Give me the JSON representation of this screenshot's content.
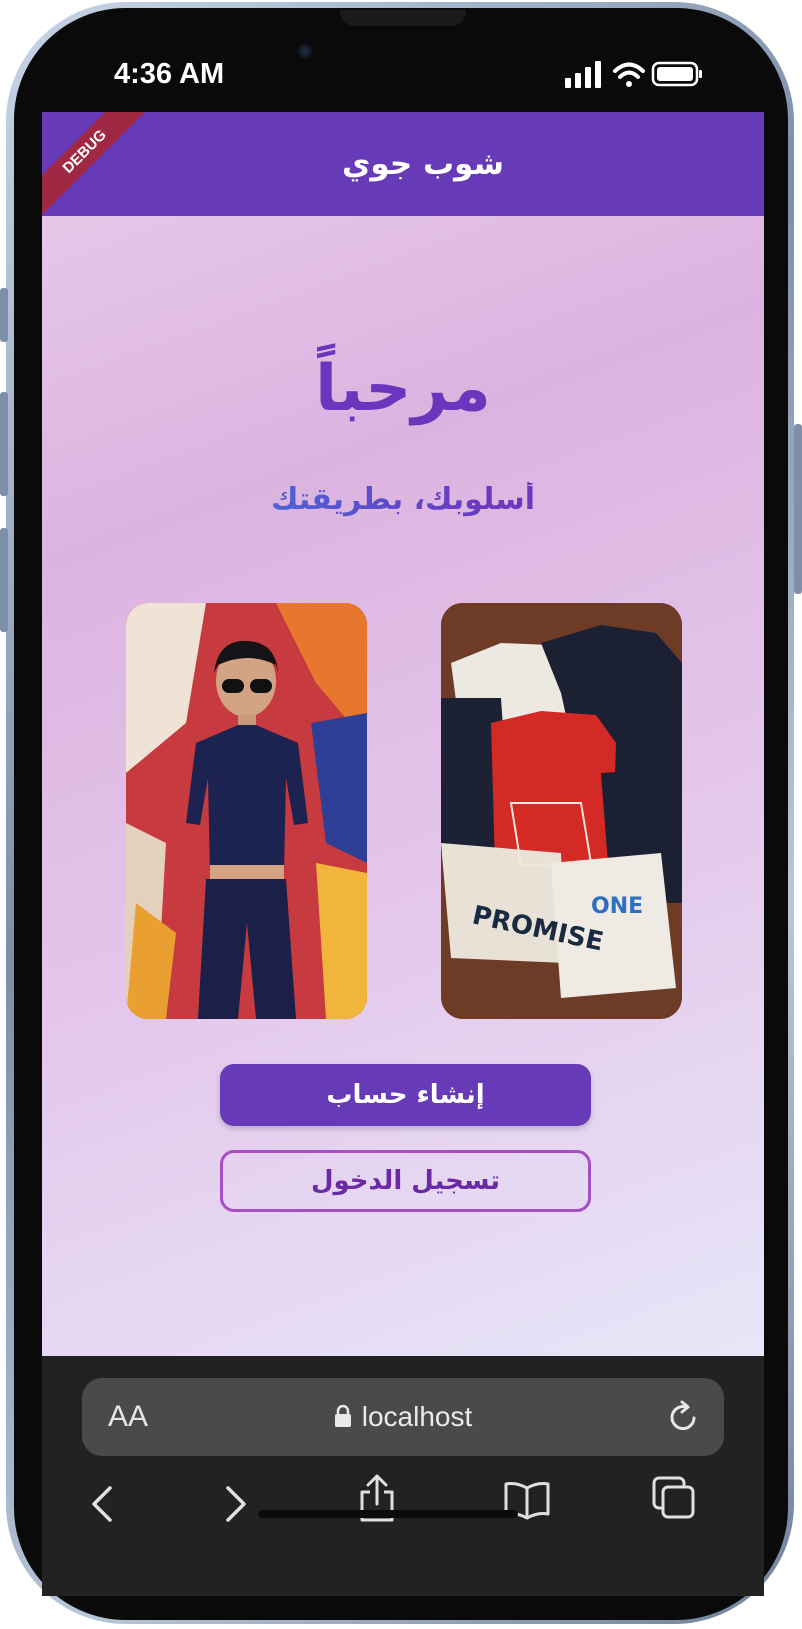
{
  "status_bar": {
    "time": "4:36 AM"
  },
  "app_bar": {
    "title": "شوب جوي",
    "debug_label": "DEBUG"
  },
  "welcome": {
    "heading": "مرحباً",
    "tagline": "أسلوبك، بطريقتك"
  },
  "buttons": {
    "create_account": "إنشاء حساب",
    "login": "تسجيل الدخول"
  },
  "browser": {
    "aa_label": "AA",
    "url": "localhost"
  },
  "colors": {
    "primary": "#673ab7",
    "outline": "#a64fc4"
  }
}
